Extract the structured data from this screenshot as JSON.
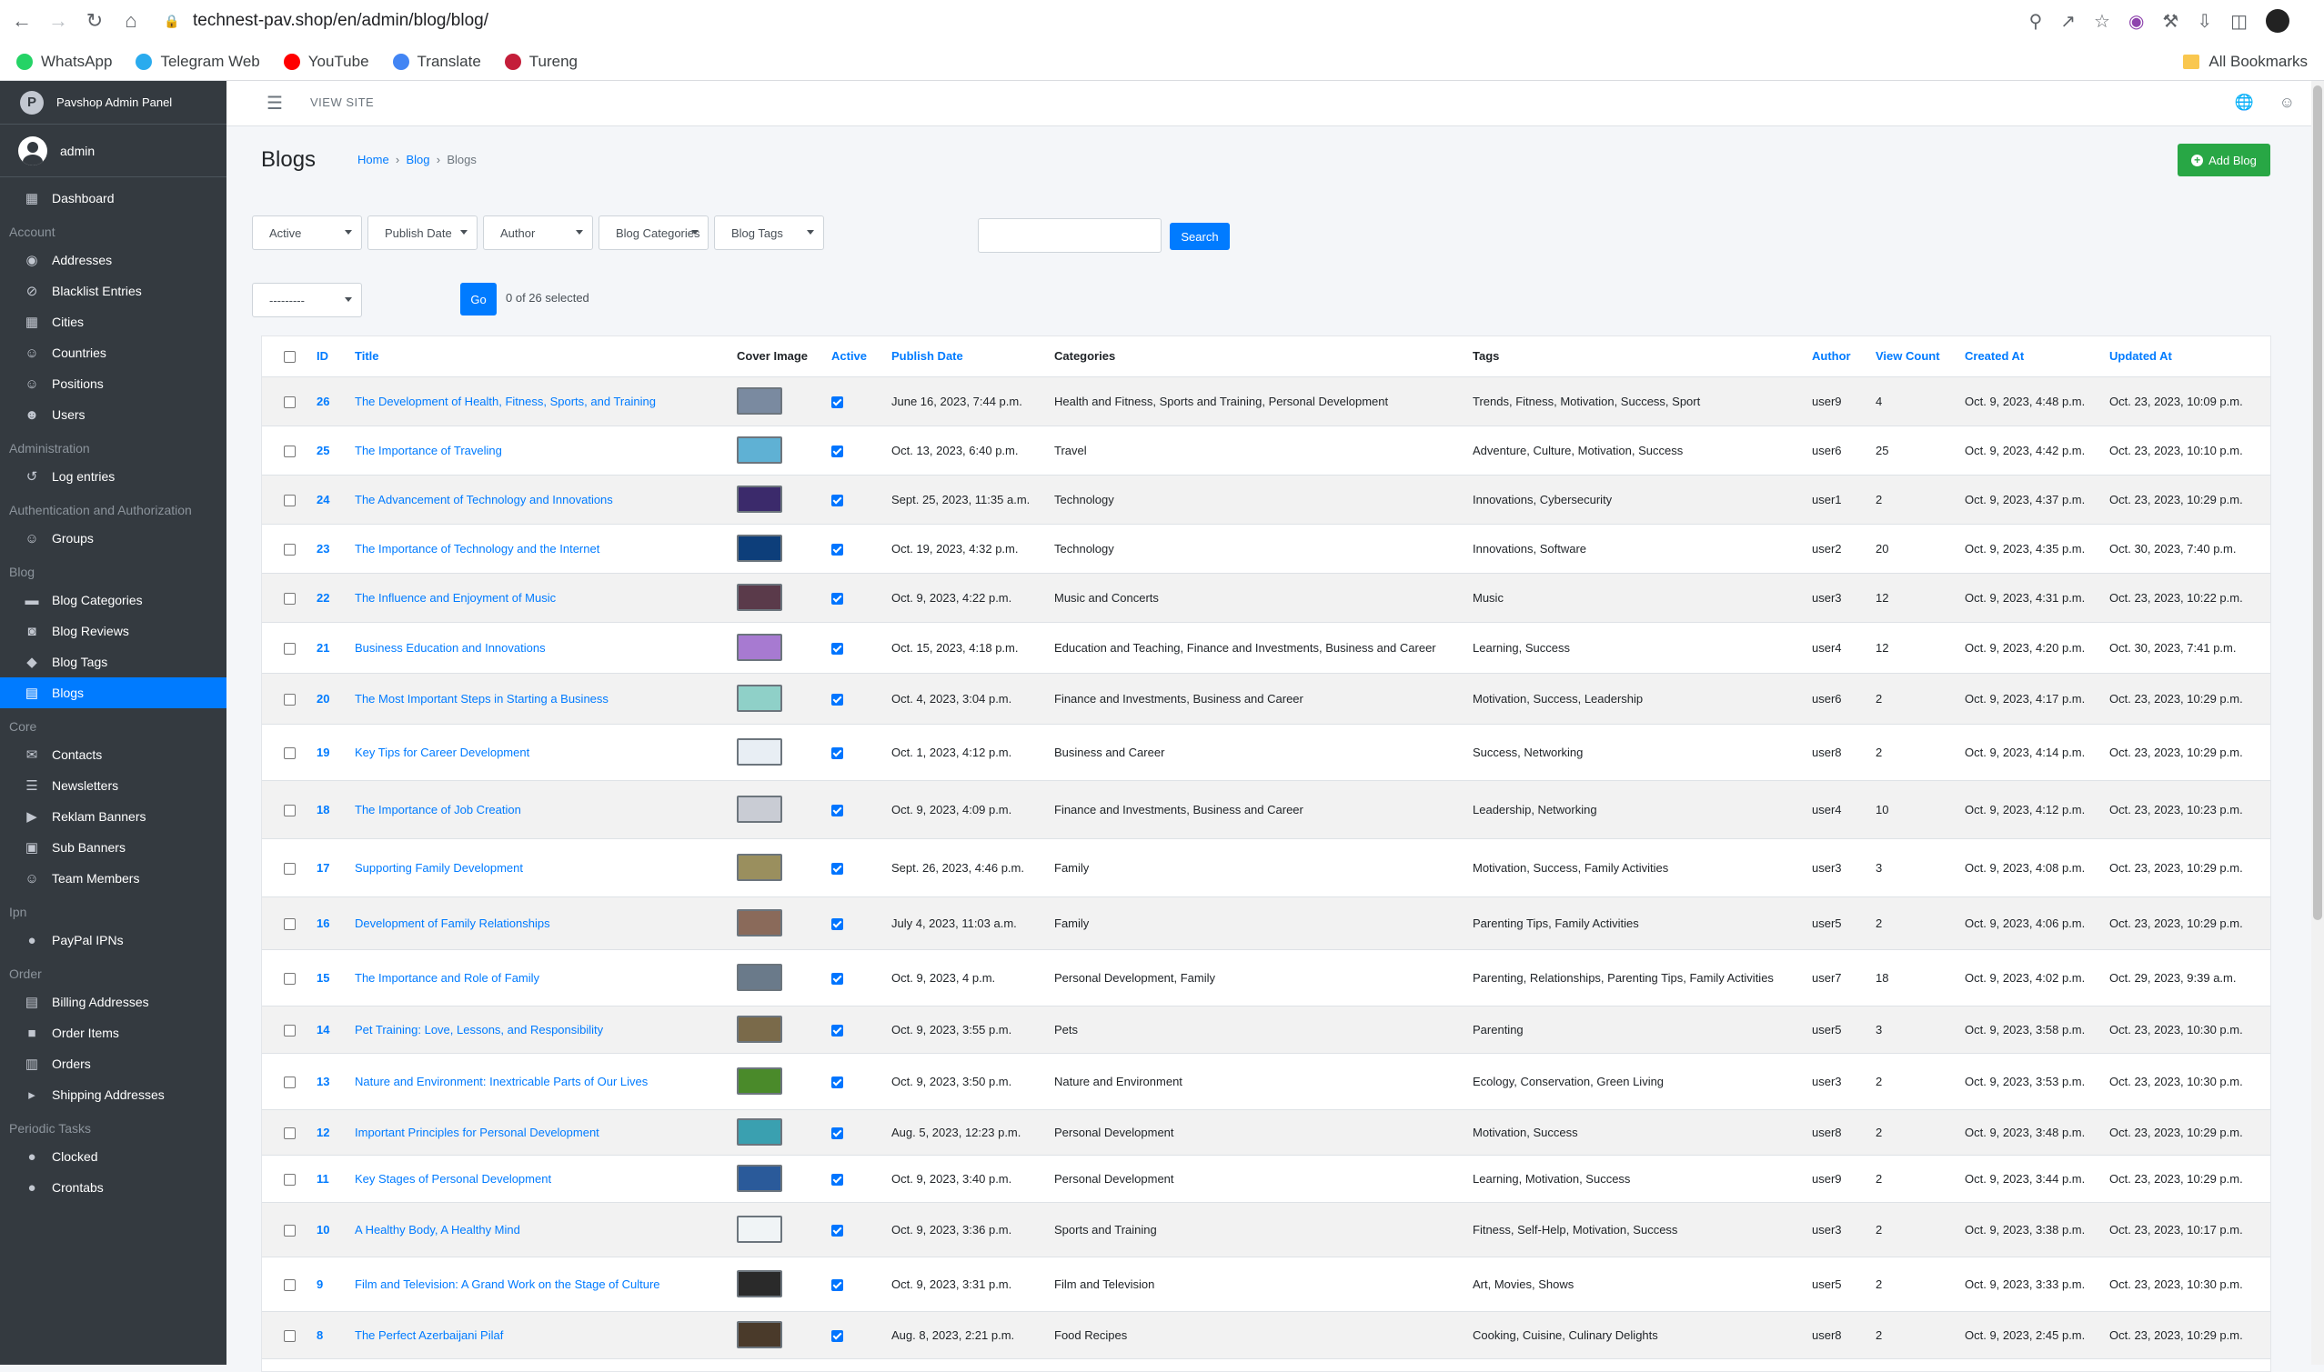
{
  "browser": {
    "url": "technest-pav.shop/en/admin/blog/blog/",
    "bookmarks": [
      {
        "label": "WhatsApp",
        "color": "#25d366"
      },
      {
        "label": "Telegram Web",
        "color": "#2aabee"
      },
      {
        "label": "YouTube",
        "color": "#ff0000"
      },
      {
        "label": "Translate",
        "color": "#4285f4"
      },
      {
        "label": "Tureng",
        "color": "#c41e3a"
      }
    ],
    "all_bookmarks": "All Bookmarks"
  },
  "sidebar": {
    "brand": "Pavshop Admin Panel",
    "user": "admin",
    "dashboard": "Dashboard",
    "sections": [
      {
        "header": "Account",
        "items": [
          {
            "label": "Addresses",
            "icon": "map-marker-icon"
          },
          {
            "label": "Blacklist Entries",
            "icon": "ban-icon"
          },
          {
            "label": "Cities",
            "icon": "city-icon"
          },
          {
            "label": "Countries",
            "icon": "users-icon"
          },
          {
            "label": "Positions",
            "icon": "users-icon"
          },
          {
            "label": "Users",
            "icon": "user-icon"
          }
        ]
      },
      {
        "header": "Administration",
        "items": [
          {
            "label": "Log entries",
            "icon": "history-icon"
          }
        ]
      },
      {
        "header": "Authentication and Authorization",
        "items": [
          {
            "label": "Groups",
            "icon": "users-icon"
          }
        ]
      },
      {
        "header": "Blog",
        "items": [
          {
            "label": "Blog Categories",
            "icon": "folder-icon"
          },
          {
            "label": "Blog Reviews",
            "icon": "comments-icon"
          },
          {
            "label": "Blog Tags",
            "icon": "tag-icon"
          },
          {
            "label": "Blogs",
            "icon": "newspaper-icon",
            "active": true
          }
        ]
      },
      {
        "header": "Core",
        "items": [
          {
            "label": "Contacts",
            "icon": "envelope-icon"
          },
          {
            "label": "Newsletters",
            "icon": "list-icon"
          },
          {
            "label": "Reklam Banners",
            "icon": "bullhorn-icon"
          },
          {
            "label": "Sub Banners",
            "icon": "image-icon"
          },
          {
            "label": "Team Members",
            "icon": "users-icon"
          }
        ]
      },
      {
        "header": "Ipn",
        "items": [
          {
            "label": "PayPal IPNs",
            "icon": "circle-icon"
          }
        ]
      },
      {
        "header": "Order",
        "items": [
          {
            "label": "Billing Addresses",
            "icon": "address-card-icon"
          },
          {
            "label": "Order Items",
            "icon": "box-icon"
          },
          {
            "label": "Orders",
            "icon": "receipt-icon"
          },
          {
            "label": "Shipping Addresses",
            "icon": "truck-icon"
          }
        ]
      },
      {
        "header": "Periodic Tasks",
        "items": [
          {
            "label": "Clocked",
            "icon": "circle-icon"
          },
          {
            "label": "Crontabs",
            "icon": "circle-icon"
          }
        ]
      }
    ]
  },
  "topnav": {
    "view_site": "VIEW SITE"
  },
  "page": {
    "title": "Blogs",
    "breadcrumb": [
      "Home",
      "Blog",
      "Blogs"
    ],
    "add_button": "Add Blog"
  },
  "filters": {
    "active": "Active",
    "publish_date": "Publish Date",
    "author": "Author",
    "categories": "Blog Categories",
    "tags": "Blog Tags",
    "search_button": "Search",
    "action": "---------",
    "go": "Go",
    "selected": "0 of 26 selected"
  },
  "table": {
    "columns": [
      "ID",
      "Title",
      "Cover Image",
      "Active",
      "Publish Date",
      "Categories",
      "Tags",
      "Author",
      "View Count",
      "Created At",
      "Updated At"
    ],
    "rows": [
      {
        "id": "26",
        "title": "The Development of Health, Fitness, Sports, and Training",
        "img": "#7a8aa0",
        "publish": "June 16, 2023, 7:44 p.m.",
        "categories": "Health and Fitness, Sports and Training, Personal Development",
        "tags": "Trends, Fitness, Motivation, Success, Sport",
        "author": "user9",
        "views": "4",
        "created": "Oct. 9, 2023, 4:48 p.m.",
        "updated": "Oct. 23, 2023, 10:09 p.m."
      },
      {
        "id": "25",
        "title": "The Importance of Traveling",
        "img": "#5fb1d4",
        "publish": "Oct. 13, 2023, 6:40 p.m.",
        "categories": "Travel",
        "tags": "Adventure, Culture, Motivation, Success",
        "author": "user6",
        "views": "25",
        "created": "Oct. 9, 2023, 4:42 p.m.",
        "updated": "Oct. 23, 2023, 10:10 p.m."
      },
      {
        "id": "24",
        "title": "The Advancement of Technology and Innovations",
        "img": "#3b2a6b",
        "publish": "Sept. 25, 2023, 11:35 a.m.",
        "categories": "Technology",
        "tags": "Innovations, Cybersecurity",
        "author": "user1",
        "views": "2",
        "created": "Oct. 9, 2023, 4:37 p.m.",
        "updated": "Oct. 23, 2023, 10:29 p.m."
      },
      {
        "id": "23",
        "title": "The Importance of Technology and the Internet",
        "img": "#0d3e7a",
        "publish": "Oct. 19, 2023, 4:32 p.m.",
        "categories": "Technology",
        "tags": "Innovations, Software",
        "author": "user2",
        "views": "20",
        "created": "Oct. 9, 2023, 4:35 p.m.",
        "updated": "Oct. 30, 2023, 7:40 p.m."
      },
      {
        "id": "22",
        "title": "The Influence and Enjoyment of Music",
        "img": "#5a3a4a",
        "publish": "Oct. 9, 2023, 4:22 p.m.",
        "categories": "Music and Concerts",
        "tags": "Music",
        "author": "user3",
        "views": "12",
        "created": "Oct. 9, 2023, 4:31 p.m.",
        "updated": "Oct. 23, 2023, 10:22 p.m."
      },
      {
        "id": "21",
        "title": "Business Education and Innovations",
        "img": "#a77ad1",
        "publish": "Oct. 15, 2023, 4:18 p.m.",
        "categories": "Education and Teaching, Finance and Investments, Business and Career",
        "tags": "Learning, Success",
        "author": "user4",
        "views": "12",
        "created": "Oct. 9, 2023, 4:20 p.m.",
        "updated": "Oct. 30, 2023, 7:41 p.m."
      },
      {
        "id": "20",
        "title": "The Most Important Steps in Starting a Business",
        "img": "#8fd0c8",
        "publish": "Oct. 4, 2023, 3:04 p.m.",
        "categories": "Finance and Investments, Business and Career",
        "tags": "Motivation, Success, Leadership",
        "author": "user6",
        "views": "2",
        "created": "Oct. 9, 2023, 4:17 p.m.",
        "updated": "Oct. 23, 2023, 10:29 p.m."
      },
      {
        "id": "19",
        "title": "Key Tips for Career Development",
        "img": "#e8eef4",
        "publish": "Oct. 1, 2023, 4:12 p.m.",
        "categories": "Business and Career",
        "tags": "Success, Networking",
        "author": "user8",
        "views": "2",
        "created": "Oct. 9, 2023, 4:14 p.m.",
        "updated": "Oct. 23, 2023, 10:29 p.m."
      },
      {
        "id": "18",
        "title": "The Importance of Job Creation",
        "img": "#c9ccd4",
        "publish": "Oct. 9, 2023, 4:09 p.m.",
        "categories": "Finance and Investments, Business and Career",
        "tags": "Leadership, Networking",
        "author": "user4",
        "views": "10",
        "created": "Oct. 9, 2023, 4:12 p.m.",
        "updated": "Oct. 23, 2023, 10:23 p.m."
      },
      {
        "id": "17",
        "title": "Supporting Family Development",
        "img": "#9a8f5e",
        "publish": "Sept. 26, 2023, 4:46 p.m.",
        "categories": "Family",
        "tags": "Motivation, Success, Family Activities",
        "author": "user3",
        "views": "3",
        "created": "Oct. 9, 2023, 4:08 p.m.",
        "updated": "Oct. 23, 2023, 10:29 p.m."
      },
      {
        "id": "16",
        "title": "Development of Family Relationships",
        "img": "#8a6a5a",
        "publish": "July 4, 2023, 11:03 a.m.",
        "categories": "Family",
        "tags": "Parenting Tips, Family Activities",
        "author": "user5",
        "views": "2",
        "created": "Oct. 9, 2023, 4:06 p.m.",
        "updated": "Oct. 23, 2023, 10:29 p.m."
      },
      {
        "id": "15",
        "title": "The Importance and Role of Family",
        "img": "#6a7a8a",
        "publish": "Oct. 9, 2023, 4 p.m.",
        "categories": "Personal Development, Family",
        "tags": "Parenting, Relationships, Parenting Tips, Family Activities",
        "author": "user7",
        "views": "18",
        "created": "Oct. 9, 2023, 4:02 p.m.",
        "updated": "Oct. 29, 2023, 9:39 a.m."
      },
      {
        "id": "14",
        "title": "Pet Training: Love, Lessons, and Responsibility",
        "img": "#7a6a4a",
        "publish": "Oct. 9, 2023, 3:55 p.m.",
        "categories": "Pets",
        "tags": "Parenting",
        "author": "user5",
        "views": "3",
        "created": "Oct. 9, 2023, 3:58 p.m.",
        "updated": "Oct. 23, 2023, 10:30 p.m."
      },
      {
        "id": "13",
        "title": "Nature and Environment: Inextricable Parts of Our Lives",
        "img": "#4a8a2a",
        "publish": "Oct. 9, 2023, 3:50 p.m.",
        "categories": "Nature and Environment",
        "tags": "Ecology, Conservation, Green Living",
        "author": "user3",
        "views": "2",
        "created": "Oct. 9, 2023, 3:53 p.m.",
        "updated": "Oct. 23, 2023, 10:30 p.m."
      },
      {
        "id": "12",
        "title": "Important Principles for Personal Development",
        "img": "#3aa0b0",
        "publish": "Aug. 5, 2023, 12:23 p.m.",
        "categories": "Personal Development",
        "tags": "Motivation, Success",
        "author": "user8",
        "views": "2",
        "created": "Oct. 9, 2023, 3:48 p.m.",
        "updated": "Oct. 23, 2023, 10:29 p.m."
      },
      {
        "id": "11",
        "title": "Key Stages of Personal Development",
        "img": "#2a5a9a",
        "publish": "Oct. 9, 2023, 3:40 p.m.",
        "categories": "Personal Development",
        "tags": "Learning, Motivation, Success",
        "author": "user9",
        "views": "2",
        "created": "Oct. 9, 2023, 3:44 p.m.",
        "updated": "Oct. 23, 2023, 10:29 p.m."
      },
      {
        "id": "10",
        "title": "A Healthy Body, A Healthy Mind",
        "img": "#f0f4f6",
        "publish": "Oct. 9, 2023, 3:36 p.m.",
        "categories": "Sports and Training",
        "tags": "Fitness, Self-Help, Motivation, Success",
        "author": "user3",
        "views": "2",
        "created": "Oct. 9, 2023, 3:38 p.m.",
        "updated": "Oct. 23, 2023, 10:17 p.m."
      },
      {
        "id": "9",
        "title": "Film and Television: A Grand Work on the Stage of Culture",
        "img": "#2a2a2a",
        "publish": "Oct. 9, 2023, 3:31 p.m.",
        "categories": "Film and Television",
        "tags": "Art, Movies, Shows",
        "author": "user5",
        "views": "2",
        "created": "Oct. 9, 2023, 3:33 p.m.",
        "updated": "Oct. 23, 2023, 10:30 p.m."
      },
      {
        "id": "8",
        "title": "The Perfect Azerbaijani Pilaf",
        "img": "#4a3a2a",
        "publish": "Aug. 8, 2023, 2:21 p.m.",
        "categories": "Food Recipes",
        "tags": "Cooking, Cuisine, Culinary Delights",
        "author": "user8",
        "views": "2",
        "created": "Oct. 9, 2023, 2:45 p.m.",
        "updated": "Oct. 23, 2023, 10:29 p.m."
      }
    ]
  }
}
